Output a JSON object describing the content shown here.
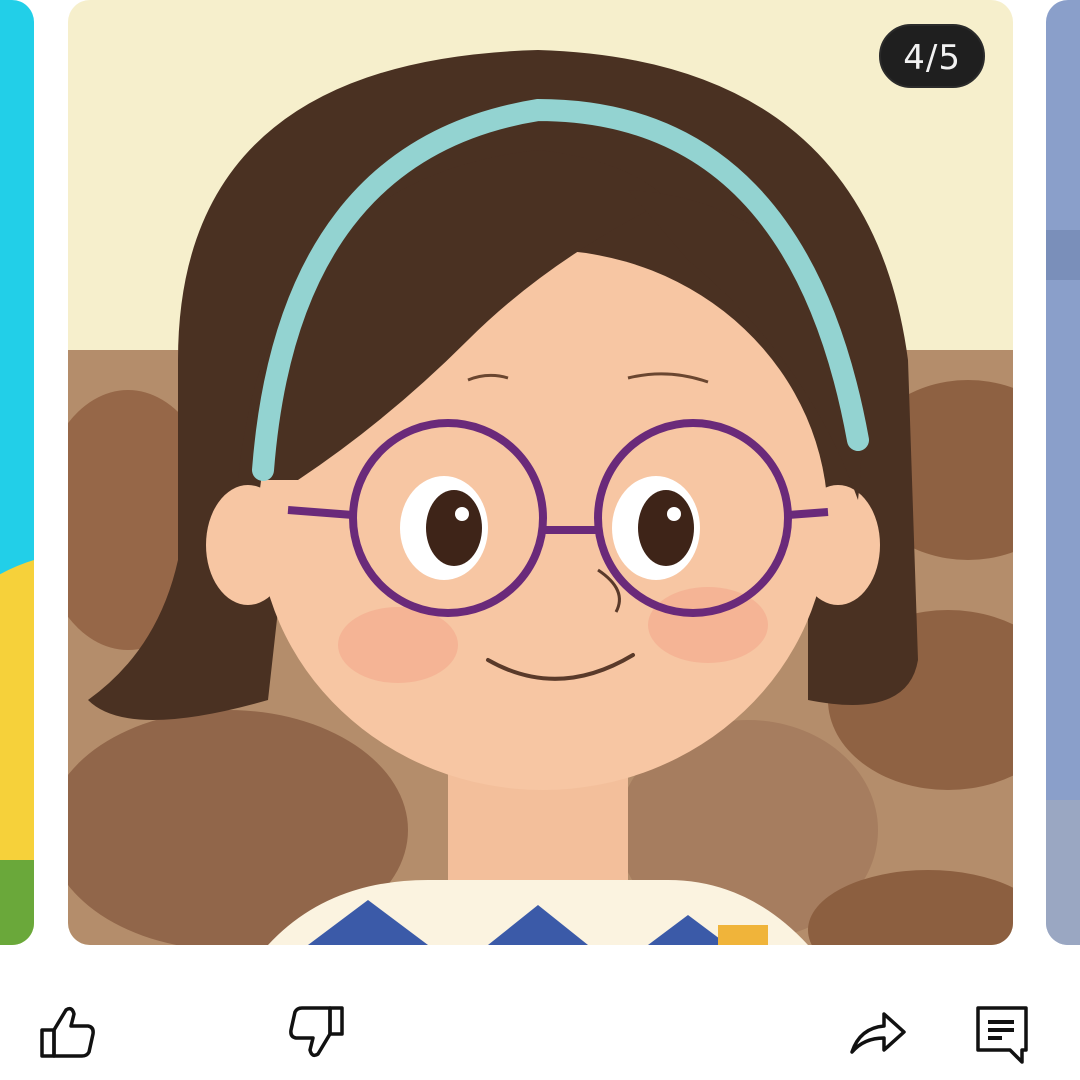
{
  "slideshow": {
    "counter": "4/5"
  },
  "actions": {
    "like_icon": "thumbs-up-icon",
    "dislike_icon": "thumbs-down-icon",
    "share_icon": "share-arrow-icon",
    "comment_icon": "comment-icon"
  },
  "colors": {
    "prev_card_top": "#22cfe8",
    "prev_card_mid": "#f6d13a",
    "prev_card_bottom": "#6aa83a",
    "next_card": "#8a9fca",
    "main_bg_top": "#f6efcc",
    "couch": "#a57a56",
    "hair": "#4a3122",
    "headband": "#93d3d1",
    "skin": "#f7c6a3",
    "glasses": "#6a2a7a"
  }
}
